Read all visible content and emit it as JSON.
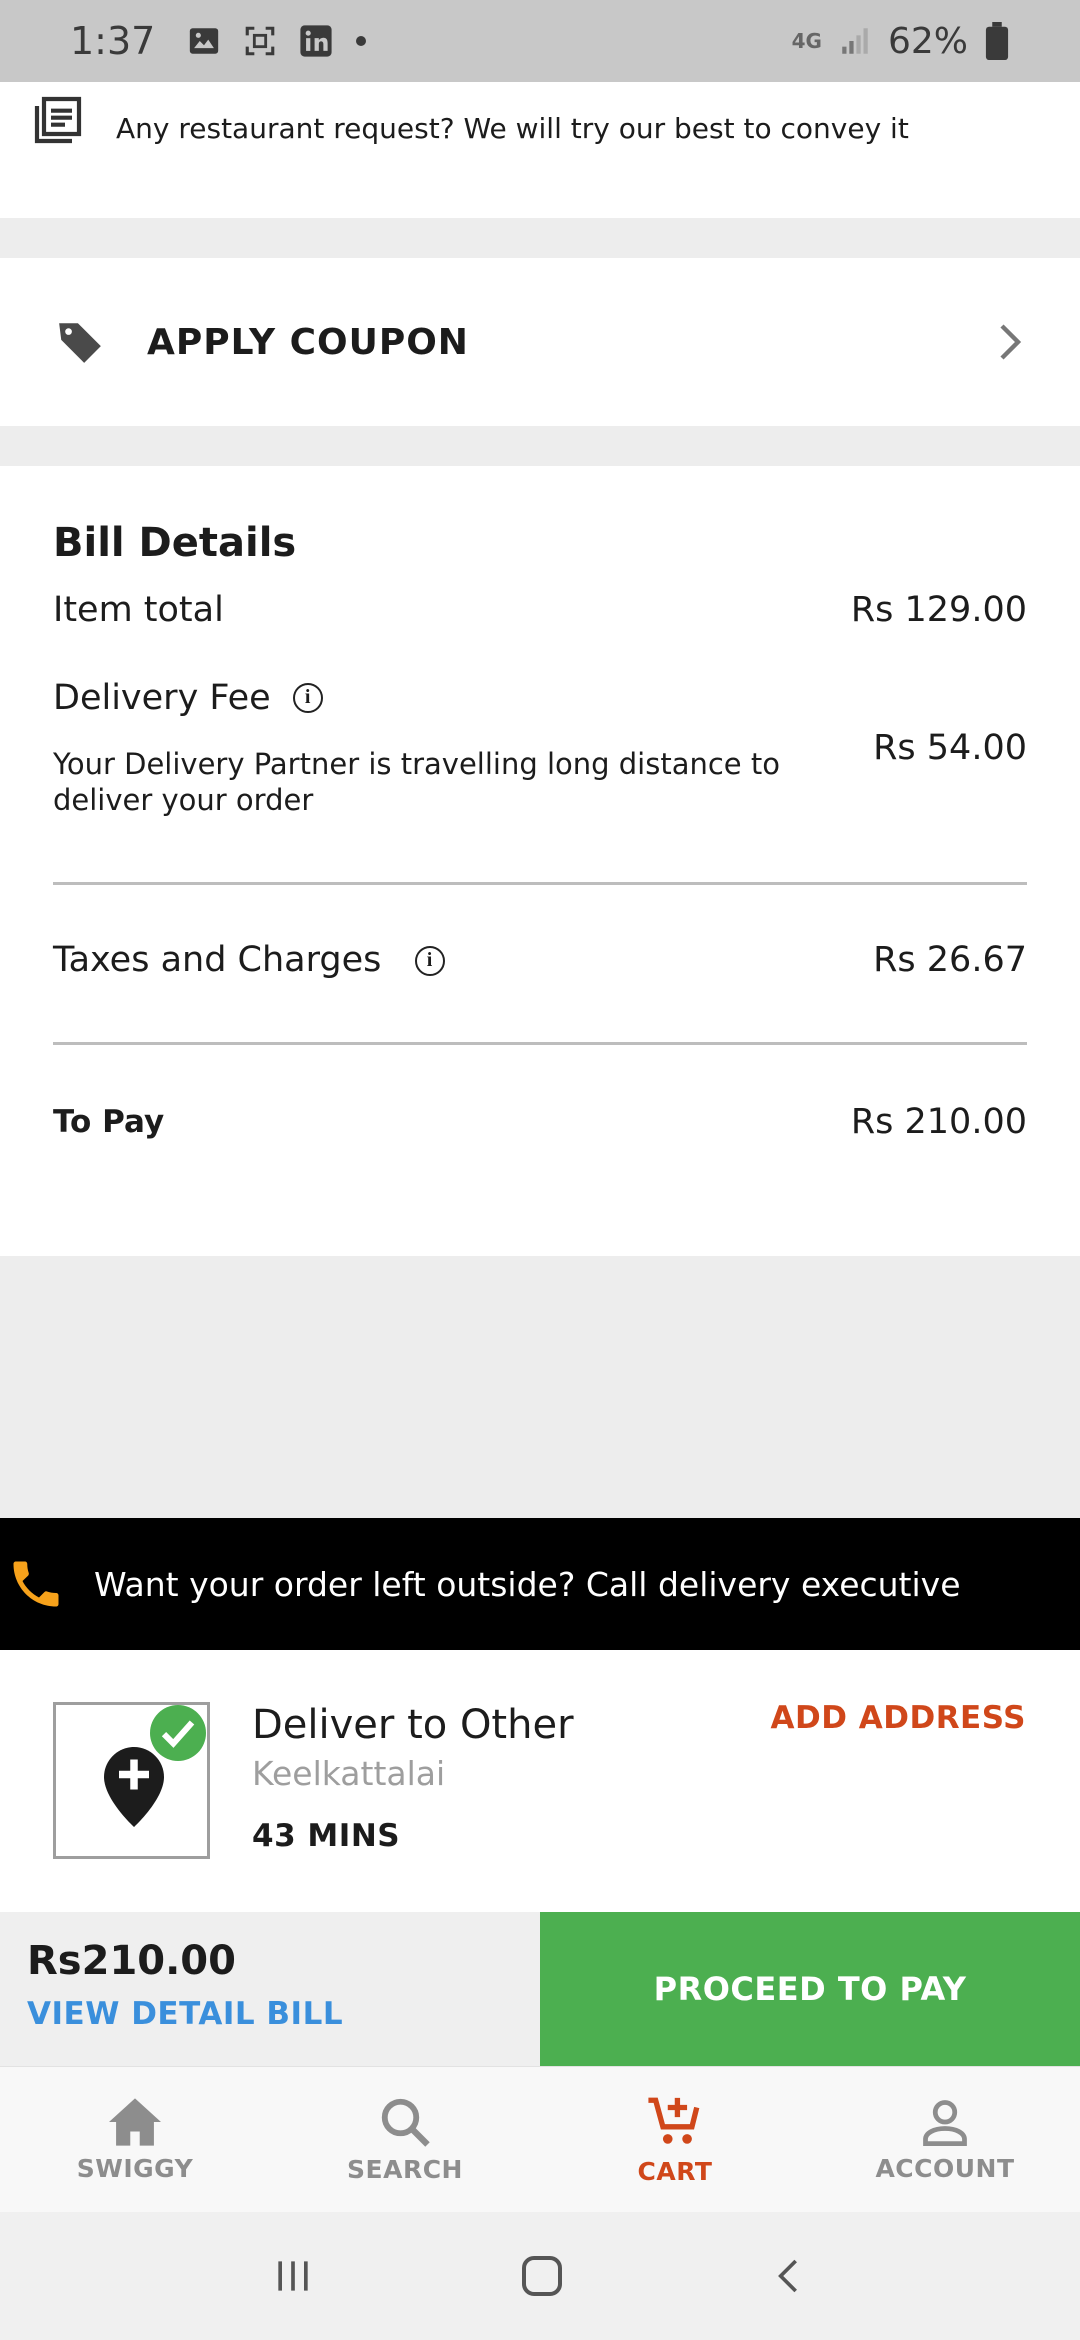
{
  "status_bar": {
    "time": "1:37",
    "network": "4G",
    "battery": "62%"
  },
  "request_row": {
    "text": "Any restaurant request? We will try our best to convey it",
    "icon": "note-icon"
  },
  "coupon": {
    "label": "APPLY COUPON",
    "icon": "tag-icon"
  },
  "bill": {
    "title": "Bill Details",
    "item_total_label": "Item total",
    "item_total_value": "Rs 129.00",
    "delivery_fee_label": "Delivery Fee",
    "delivery_fee_note": "Your Delivery Partner is travelling long distance to deliver your order",
    "delivery_fee_value": "Rs 54.00",
    "taxes_label": "Taxes and Charges",
    "taxes_value": "Rs 26.67",
    "to_pay_label": "To Pay",
    "to_pay_value": "Rs 210.00"
  },
  "banner": {
    "text": "Want your order left outside? Call delivery executive",
    "icon_color": "#f7a21b"
  },
  "address": {
    "title": "Deliver to Other",
    "area": "Keelkattalai",
    "eta": "43 MINS",
    "add_label": "ADD ADDRESS"
  },
  "paybar": {
    "amount": "Rs210.00",
    "detail_label": "VIEW DETAIL BILL",
    "proceed_label": "PROCEED TO PAY"
  },
  "tabs": [
    {
      "label": "SWIGGY",
      "icon": "home-icon"
    },
    {
      "label": "SEARCH",
      "icon": "search-icon"
    },
    {
      "label": "CART",
      "icon": "cart-icon",
      "active": true
    },
    {
      "label": "ACCOUNT",
      "icon": "account-icon"
    }
  ],
  "colors": {
    "accent": "#d0471a",
    "green": "#4caf50",
    "link": "#3a8fdc"
  }
}
